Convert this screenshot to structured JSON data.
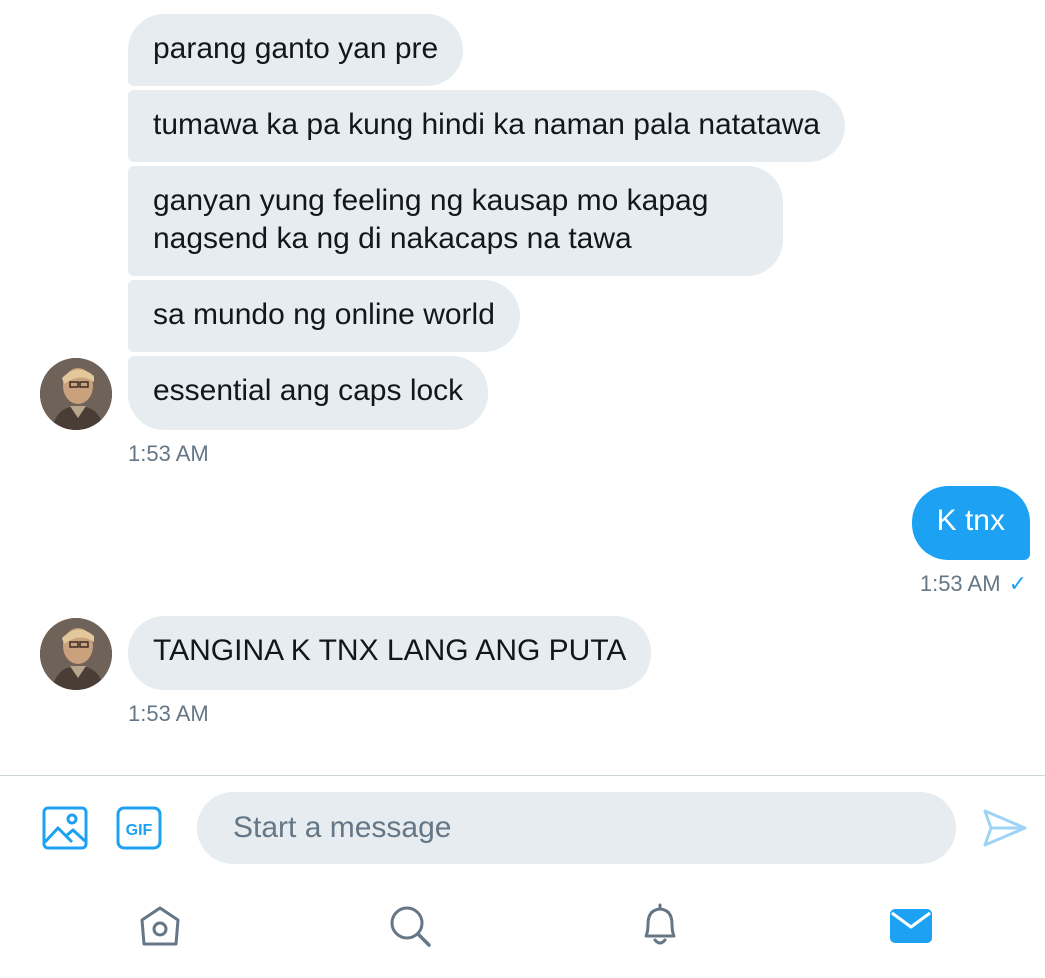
{
  "conversation": {
    "incoming_group_1": [
      "parang ganto yan pre",
      "tumawa ka pa kung hindi ka naman pala natatawa",
      "ganyan yung feeling ng kausap mo kapag nagsend ka ng di nakacaps na tawa",
      "sa mundo ng online world",
      "essential ang caps lock"
    ],
    "incoming_group_1_time": "1:53 AM",
    "outgoing": {
      "text": "K tnx",
      "time": "1:53 AM",
      "status_icon": "checkmark-icon"
    },
    "incoming_group_2": [
      "TANGINA K TNX LANG ANG PUTA"
    ],
    "incoming_group_2_time": "1:53 AM"
  },
  "composer": {
    "placeholder": "Start a message",
    "icons": [
      "image-icon",
      "gif-icon",
      "send-icon"
    ]
  },
  "tab_bar": {
    "icons": [
      "home-icon",
      "search-icon",
      "notifications-icon",
      "messages-icon"
    ],
    "active": "messages-icon"
  },
  "colors": {
    "accent": "#1DA1F2",
    "bubble_incoming": "#E6ECF0",
    "text": "#14171A",
    "muted": "#657786"
  }
}
